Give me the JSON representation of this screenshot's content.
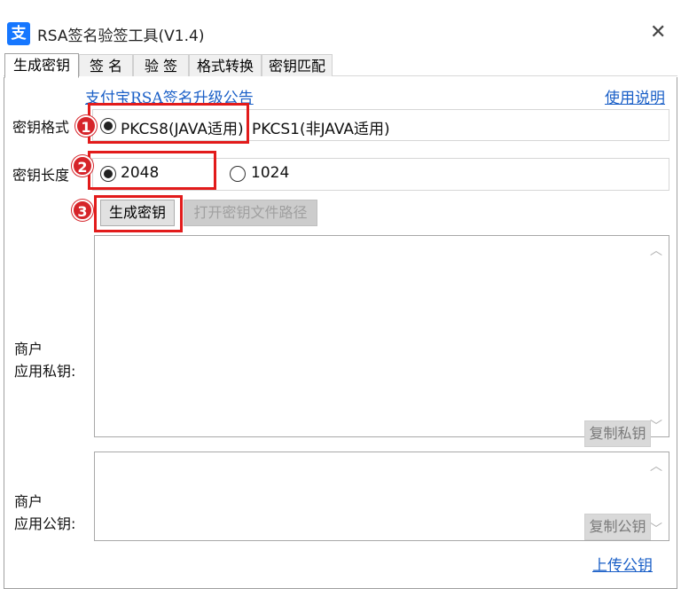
{
  "window": {
    "title": "RSA签名验签工具(V1.4)",
    "logo_icon": "alipay-icon",
    "close_icon": "close-icon"
  },
  "tabs": [
    "生成密钥",
    "签 名",
    "验 签",
    "格式转换",
    "密钥匹配"
  ],
  "links": {
    "announcement": "支付宝RSA签名升级公告",
    "help": "使用说明",
    "upload": "上传公钥"
  },
  "key_format": {
    "label": "密钥格式",
    "options": [
      "PKCS8(JAVA适用)",
      "PKCS1(非JAVA适用)"
    ],
    "selected": "PKCS8(JAVA适用)"
  },
  "key_length": {
    "label": "密钥长度",
    "options": [
      "2048",
      "1024"
    ],
    "selected": "2048"
  },
  "buttons": {
    "generate": "生成密钥",
    "open_path": "打开密钥文件路径",
    "copy_private": "复制私钥",
    "copy_public": "复制公钥"
  },
  "private_key": {
    "label_line1": "商户",
    "label_line2": "应用私钥:",
    "value": ""
  },
  "public_key": {
    "label_line1": "商户",
    "label_line2": "应用公钥:",
    "value": ""
  },
  "markers": [
    "1",
    "2",
    "3"
  ],
  "colors": {
    "highlight": "#e21b1b",
    "link": "#1a5fc7",
    "brand": "#1677ff"
  }
}
